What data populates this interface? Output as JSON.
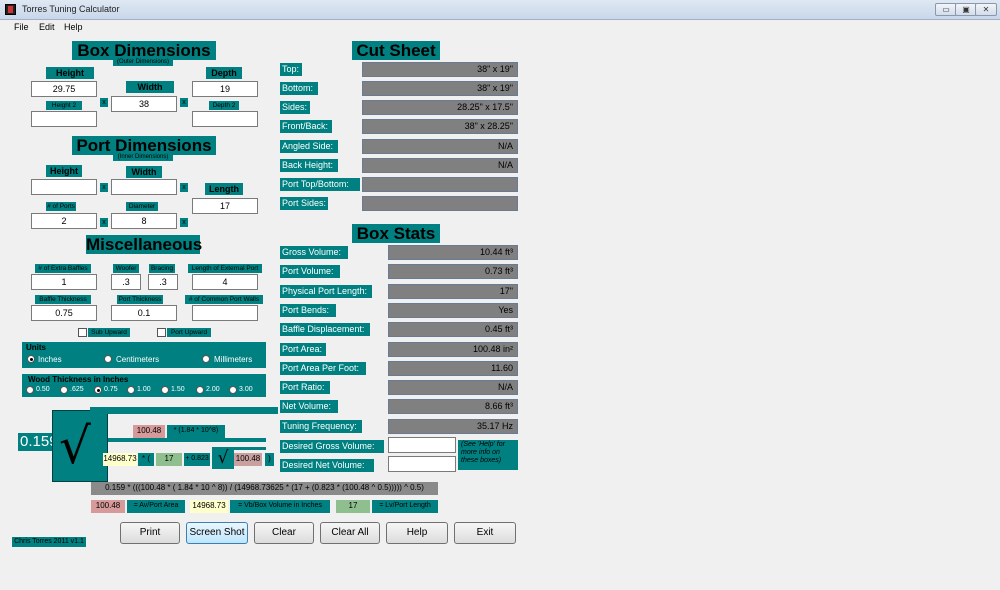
{
  "window": {
    "title": "Torres Tuning Calculator",
    "buttons": [
      "▭",
      "▣",
      "✕"
    ]
  },
  "menu": [
    "File",
    "Edit",
    "Help"
  ],
  "box_dimensions": {
    "title": "Box Dimensions",
    "subtitle": "(Outer Dimensions)",
    "height_label": "Height",
    "width_label": "Width",
    "depth_label": "Depth",
    "height2_label": "Height 2",
    "depth2_label": "Depth 2",
    "height": "29.75",
    "width": "38",
    "depth": "19",
    "height2": "",
    "depth2": ""
  },
  "port_dimensions": {
    "title": "Port Dimensions",
    "subtitle": "(Inner Dimensions)",
    "height_label": "Height",
    "width_label": "Width",
    "length_label": "Length",
    "num_ports_label": "# of Ports",
    "diameter_label": "Diameter",
    "height": "",
    "width": "",
    "length": "17",
    "num_ports": "2",
    "diameter": "8"
  },
  "misc": {
    "title": "Miscellaneous",
    "extra_baffles_label": "# of Extra Baffles",
    "woofer_label": "Woofer",
    "bracing_label": "Bracing",
    "ext_port_label": "Length of External Port",
    "extra_baffles": "1",
    "woofer": ".3",
    "bracing": ".3",
    "ext_port": "4",
    "baffle_thick_label": "Baffle Thickness",
    "port_thick_label": "Port Thickness",
    "common_walls_label": "# of Common Port Walls",
    "baffle_thick": "0.75",
    "port_thick": "0.1",
    "common_walls": "",
    "sub_upward": "Sub Upward",
    "port_upward": "Port Upward"
  },
  "units": {
    "title": "Units",
    "options": [
      "Inches",
      "Centimeters",
      "Millimeters"
    ],
    "selected": "Inches"
  },
  "wood": {
    "title": "Wood Thickness in Inches",
    "options": [
      "0.50",
      ".625",
      "0.75",
      "1.00",
      "1.50",
      "2.00",
      "3.00"
    ],
    "selected": "0.75"
  },
  "formula_vis": {
    "leading": "0.159",
    "area": "100.48",
    "exp": "* (1.84 * 10^8)",
    "volume": "14968.73",
    "paren_open": "* (",
    "length": "17",
    "plus": "+ 0.823",
    "area2": "100.48",
    "paren_close": ")"
  },
  "formula_text": "0.159 * (((100.48 * ( 1.84 * 10 ^ 8)) / (14968.73625 * (17 + (0.823 * (100.48 ^ 0.5))))) ^ 0.5)",
  "legend": {
    "av_value": "100.48",
    "av_label": "= Av/Port Area",
    "vb_value": "14968.73",
    "vb_label": "= Vb/Box Volume in Inches",
    "lv_value": "17",
    "lv_label": "= Lv/Port Length"
  },
  "cut_sheet": {
    "title": "Cut Sheet",
    "rows": [
      {
        "label": "Top:",
        "value": "38\" x 19\""
      },
      {
        "label": "Bottom:",
        "value": "38\" x 19\""
      },
      {
        "label": "Sides:",
        "value": "28.25\" x 17.5\""
      },
      {
        "label": "Front/Back:",
        "value": "38\" x 28.25\""
      },
      {
        "label": "Angled Side:",
        "value": "N/A"
      },
      {
        "label": "Back Height:",
        "value": "N/A"
      },
      {
        "label": "Port Top/Bottom:",
        "value": ""
      },
      {
        "label": "Port Sides:",
        "value": ""
      }
    ]
  },
  "box_stats": {
    "title": "Box Stats",
    "rows": [
      {
        "label": "Gross Volume:",
        "value": "10.44 ft³"
      },
      {
        "label": "Port Volume:",
        "value": "0.73 ft³"
      },
      {
        "label": "Physical Port Length:",
        "value": "17\""
      },
      {
        "label": "Port Bends:",
        "value": "Yes"
      },
      {
        "label": "Baffle Displacement:",
        "value": "0.45 ft³"
      },
      {
        "label": "Port Area:",
        "value": "100.48 in²"
      },
      {
        "label": "Port Area Per Foot:",
        "value": "11.60"
      },
      {
        "label": "Port Ratio:",
        "value": "N/A"
      },
      {
        "label": "Net Volume:",
        "value": "8.66 ft³"
      },
      {
        "label": "Tuning Frequency:",
        "value": "35.17 Hz"
      }
    ],
    "desired_gross_label": "Desired Gross Volume:",
    "desired_net_label": "Desired Net Volume:",
    "desired_gross": "",
    "desired_net": "",
    "help_note": "(See 'Help' for more info on these boxes)"
  },
  "buttons": [
    "Print",
    "Screen Shot",
    "Clear",
    "Clear All",
    "Help",
    "Exit"
  ],
  "footer": "Chris Torres 2011 v1.1"
}
